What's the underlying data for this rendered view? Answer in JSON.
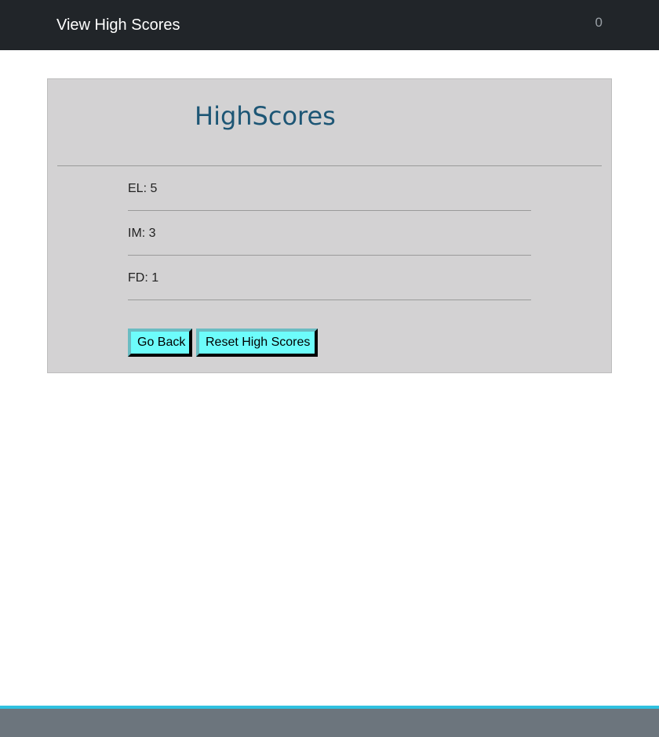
{
  "navbar": {
    "brand_label": "View High Scores",
    "timer_value": "0"
  },
  "card": {
    "title": "HighScores"
  },
  "scores": [
    {
      "text": "EL: 5"
    },
    {
      "text": "IM: 3"
    },
    {
      "text": "FD: 1"
    }
  ],
  "buttons": {
    "go_back_label": "Go Back",
    "reset_label": "Reset High Scores"
  },
  "colors": {
    "navbar_bg": "#212529",
    "card_bg": "#d3d2d3",
    "title_color": "#1d5675",
    "button_bg": "#6dfcfb",
    "footer_bg": "#6c757d",
    "footer_accent": "#2fc1e0"
  }
}
